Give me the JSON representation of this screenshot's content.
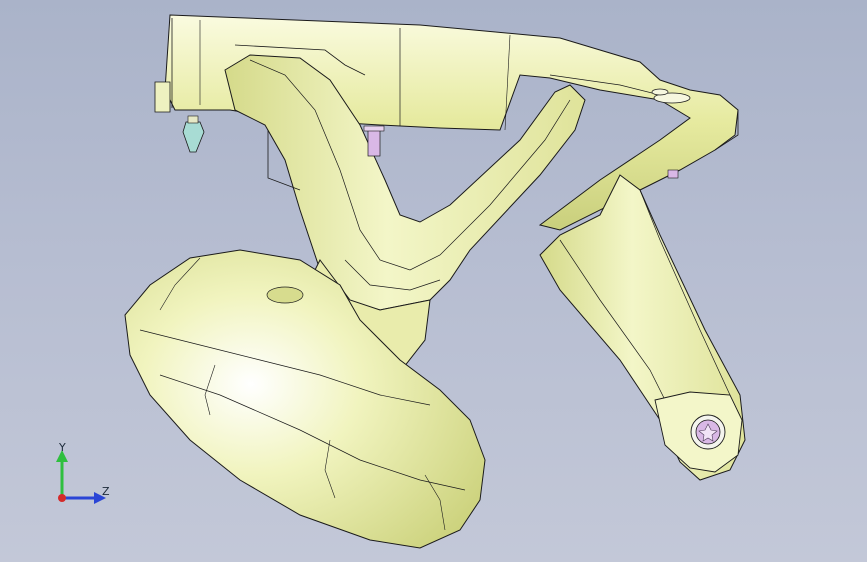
{
  "viewport": {
    "background_top": "#aab3c9",
    "background_bottom": "#c3c8d8"
  },
  "model": {
    "body_color": "#eef1b3",
    "shade_color": "#d7dc8e",
    "edge_color": "#1a1a1a",
    "fastener_color": "#d9b8e6",
    "clip_color": "#a8dcd4"
  },
  "triad": {
    "y_label": "Y",
    "z_label": "Z",
    "y_color": "#2fbf3f",
    "z_color": "#2a45d6",
    "x_color": "#d42a2a"
  }
}
